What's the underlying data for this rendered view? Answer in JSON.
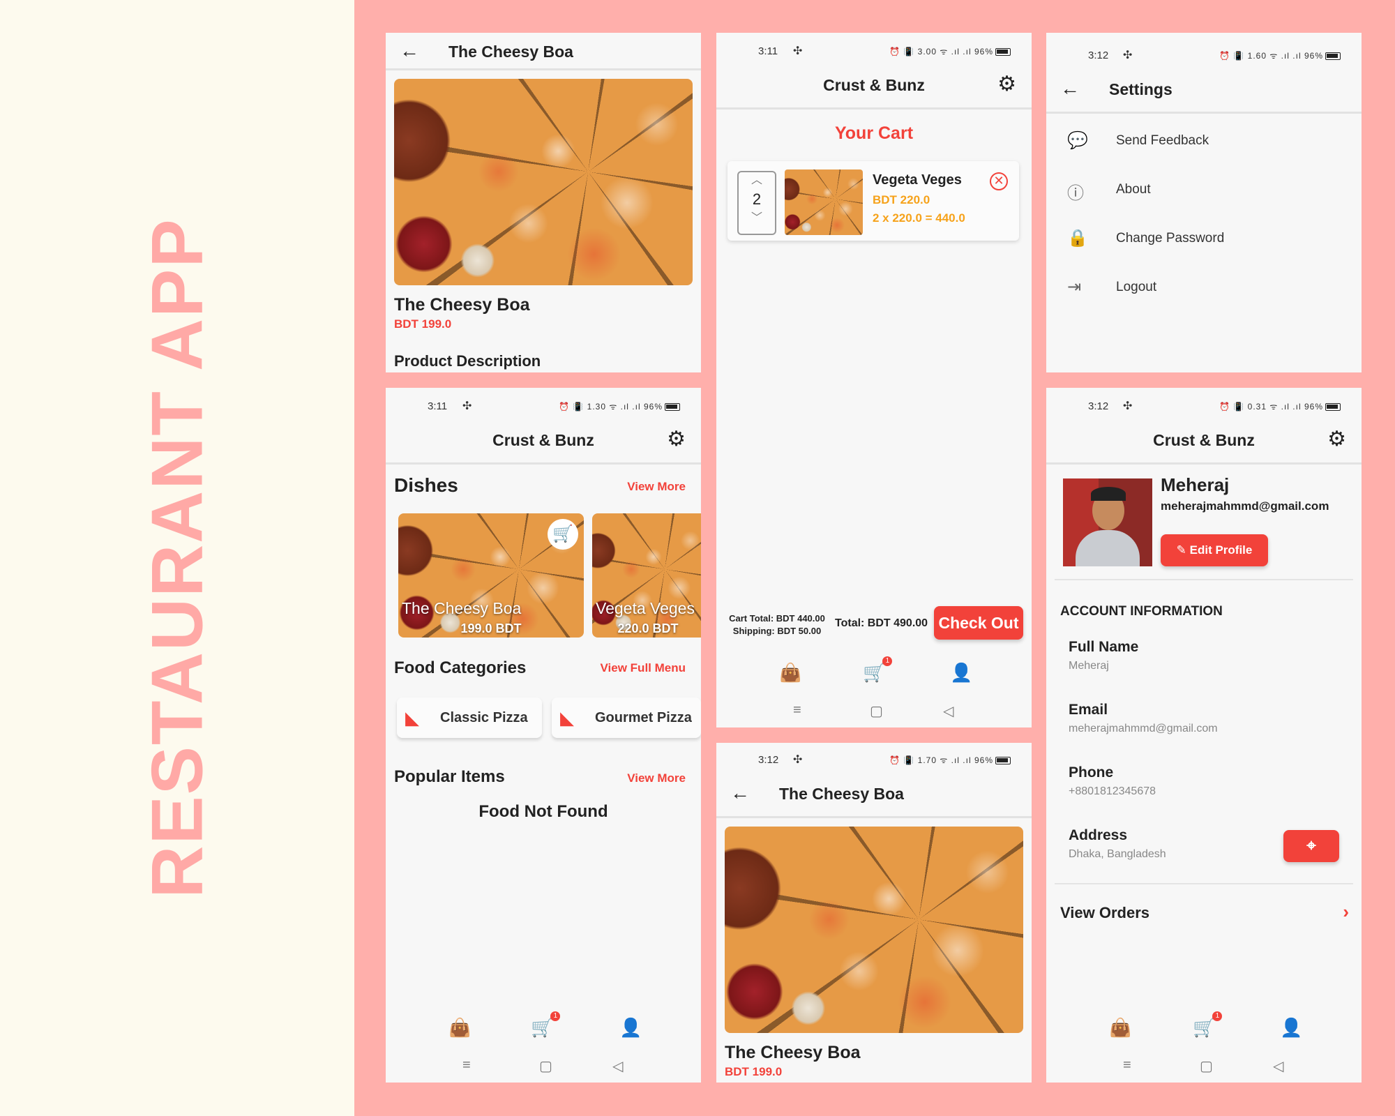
{
  "page": {
    "side_title": "RESTAURANT APP"
  },
  "detail_top": {
    "title": "The Cheesy Boa",
    "product_name": "The Cheesy Boa",
    "price": "BDT 199.0",
    "description_heading": "Product Description"
  },
  "home": {
    "status": {
      "time": "3:11",
      "icons": "⏰ 📳 1.30 ᯤ .ıl .ıl 96%"
    },
    "app_title": "Crust & Bunz",
    "dishes_title": "Dishes",
    "dishes_link": "View More",
    "dishes": [
      {
        "name": "The Cheesy Boa",
        "price": "199.0 BDT"
      },
      {
        "name": "Vegeta Veges",
        "price": "220.0 BDT"
      }
    ],
    "categories_title": "Food Categories",
    "categories_link": "View Full Menu",
    "categories": [
      "Classic Pizza",
      "Gourmet Pizza"
    ],
    "popular_title": "Popular Items",
    "popular_link": "View More",
    "popular_empty": "Food Not Found",
    "cart_badge": "1"
  },
  "cart": {
    "status": {
      "time": "3:11",
      "icons": "⏰ 📳 3.00 ᯤ .ıl .ıl 96%"
    },
    "app_title": "Crust & Bunz",
    "heading": "Your Cart",
    "item": {
      "qty": "2",
      "name": "Vegeta Veges",
      "price": "BDT 220.0",
      "subtotal": "2 x 220.0 = 440.0"
    },
    "cart_total": "Cart Total: BDT 440.00",
    "shipping": "Shipping: BDT 50.00",
    "total": "Total: BDT 490.00",
    "checkout": "Check Out",
    "cart_badge": "1"
  },
  "detail_bottom": {
    "status": {
      "time": "3:12",
      "icons": "⏰ 📳 1.70 ᯤ .ıl .ıl 96%"
    },
    "title": "The Cheesy Boa",
    "product_name": "The Cheesy Boa",
    "price": "BDT 199.0"
  },
  "settings": {
    "status": {
      "time": "3:12",
      "icons": "⏰ 📳 1.60 ᯤ .ıl .ıl 96%"
    },
    "title": "Settings",
    "items": [
      "Send Feedback",
      "About",
      "Change Password",
      "Logout"
    ]
  },
  "profile": {
    "status": {
      "time": "3:12",
      "icons": "⏰ 📳 0.31 ᯤ .ıl .ıl 96%"
    },
    "app_title": "Crust & Bunz",
    "name": "Meheraj",
    "email": "meherajmahmmd@gmail.com",
    "edit_label": "Edit Profile",
    "account_heading": "ACCOUNT INFORMATION",
    "fields": [
      {
        "label": "Full Name",
        "value": "Meheraj"
      },
      {
        "label": "Email",
        "value": "meherajmahmmd@gmail.com"
      },
      {
        "label": "Phone",
        "value": "+8801812345678"
      },
      {
        "label": "Address",
        "value": "Dhaka, Bangladesh"
      }
    ],
    "view_orders": "View Orders",
    "cart_badge": "1"
  },
  "icons": {
    "back": "arrow-left-icon",
    "settings": "gear-icon",
    "cart": "cart-icon",
    "bag": "shopping-bag-icon",
    "person": "person-icon",
    "pizza": "pizza-slice-icon"
  },
  "colors": {
    "accent": "#f2423a",
    "price_orange": "#f6a21a",
    "background": "#ffafab",
    "panel": "#fdfaee"
  }
}
